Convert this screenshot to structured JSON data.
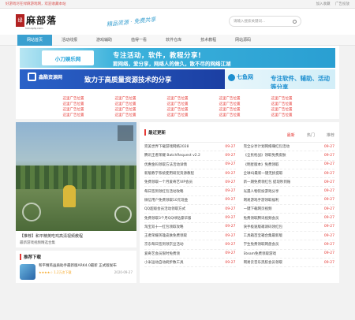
{
  "topbar": {
    "notice": "好游戏尽在绿麻游戏网，欢迎收藏本站",
    "links": [
      "加入收藏",
      "广告投放"
    ]
  },
  "header": {
    "logo_badge": "绿",
    "logo_text": "麻部落",
    "logo_sub": "lvmaplq.com",
    "slogan": "精品资源 · 免费共享",
    "search_placeholder": "请输入搜索关键词..."
  },
  "nav": [
    "网站首页",
    "活动线报",
    "游戏辅助",
    "值得一看",
    "软件仓库",
    "技术教程",
    "网站源码"
  ],
  "banners": {
    "b1_logo": "小刀娱乐网",
    "b1_line1": "专注活动，软件，教程分享!",
    "b1_line2": "要网络，爱分享，网络人的做久，散不尽的网络江湖",
    "b2_logo": "鑫酷资源网",
    "b2_text": "致力于高质量资源技术的分享",
    "b3_logo": "七鱼网",
    "b3_text": "专注软件、辅助、活动等分享"
  },
  "ads": [
    "这里广告位置",
    "这里广告位置",
    "这里广告位置",
    "这里广告位置",
    "这里广告位置",
    "这里广告位置",
    "这里广告位置",
    "这里广告位置",
    "这里广告位置",
    "这里广告位置",
    "这里广告位置",
    "这里广告位置",
    "这里广告位置",
    "这里广告位置",
    "这里广告位置",
    "这里广告位置",
    "这里广告位置",
    "这里广告位置",
    "这里广告位置",
    "这里广告位置"
  ],
  "video": {
    "caption": "【推荐】和平精英吃鸡高清视频教程",
    "sub": "最新游戏视频精选合集"
  },
  "recommend": {
    "title": "推荐下载",
    "item_name": "和平精英画质助手最新版ARK4.0最新 正式版发布",
    "item_date": "2020-09-27",
    "item_meta": "★★★★☆ 1.2万次下载"
  },
  "news": {
    "title": "最近更新",
    "tabs": [
      "最新",
      "热门",
      "推荐"
    ],
    "left": [
      {
        "t": "完美世界下载游戏网络2028",
        "d": "09-27"
      },
      {
        "t": "腾讯王者荣耀 BatchRequest v2.2",
        "d": "09-27"
      },
      {
        "t": "优惠金码领取方法活动详情",
        "d": "09-27"
      },
      {
        "t": "新版教学系统使用研究资源教程",
        "d": "09-27"
      },
      {
        "t": "免费领取一个月爱奇艺VIP会员",
        "d": "09-27"
      },
      {
        "t": "每日签到领红包活动攻略",
        "d": "09-27"
      },
      {
        "t": "微信用户免费领取10元现金",
        "d": "09-27"
      },
      {
        "t": "QQ超级会员活动领取方式",
        "d": "09-27"
      },
      {
        "t": "免费领取3个月QQ绿钻豪华版",
        "d": "09-27"
      },
      {
        "t": "淘宝双十一红包领取攻略",
        "d": "09-27"
      },
      {
        "t": "王者荣耀英雄皮肤免费领取",
        "d": "09-27"
      },
      {
        "t": "京东每日签到领京豆活动",
        "d": "09-27"
      },
      {
        "t": "爱奇艺会员限时免费领",
        "d": "09-27"
      },
      {
        "t": "小米运动自动刷步数工具",
        "d": "09-27"
      }
    ],
    "right": [
      {
        "t": "完全分享计划网络赚红包活动",
        "d": "09-27"
      },
      {
        "t": "《全民枪战》领取免费皮肤",
        "d": "09-27"
      },
      {
        "t": "《明星版本》免费领取",
        "d": "09-27"
      },
      {
        "t": "全球IQ最新一键无损提取",
        "d": "09-27"
      },
      {
        "t": "新一期免费领红包 提现秒到账",
        "d": "09-27"
      },
      {
        "t": "光遇人物装扮游戏分享",
        "d": "09-27"
      },
      {
        "t": "网易游戏手游领取福利",
        "d": "09-27"
      },
      {
        "t": "一键下载网页视频",
        "d": "09-27"
      },
      {
        "t": "免费领取腾讯视频会员",
        "d": "09-27"
      },
      {
        "t": "快手极速版邀请码领红包",
        "d": "09-27"
      },
      {
        "t": "工具箱百宝箱合集最新版",
        "d": "09-27"
      },
      {
        "t": "学生免费领取网盘会员",
        "d": "09-27"
      },
      {
        "t": "Steam免费领取游戏",
        "d": "09-27"
      },
      {
        "t": "网易云音乐黑胶会员领取",
        "d": "09-27"
      }
    ]
  }
}
